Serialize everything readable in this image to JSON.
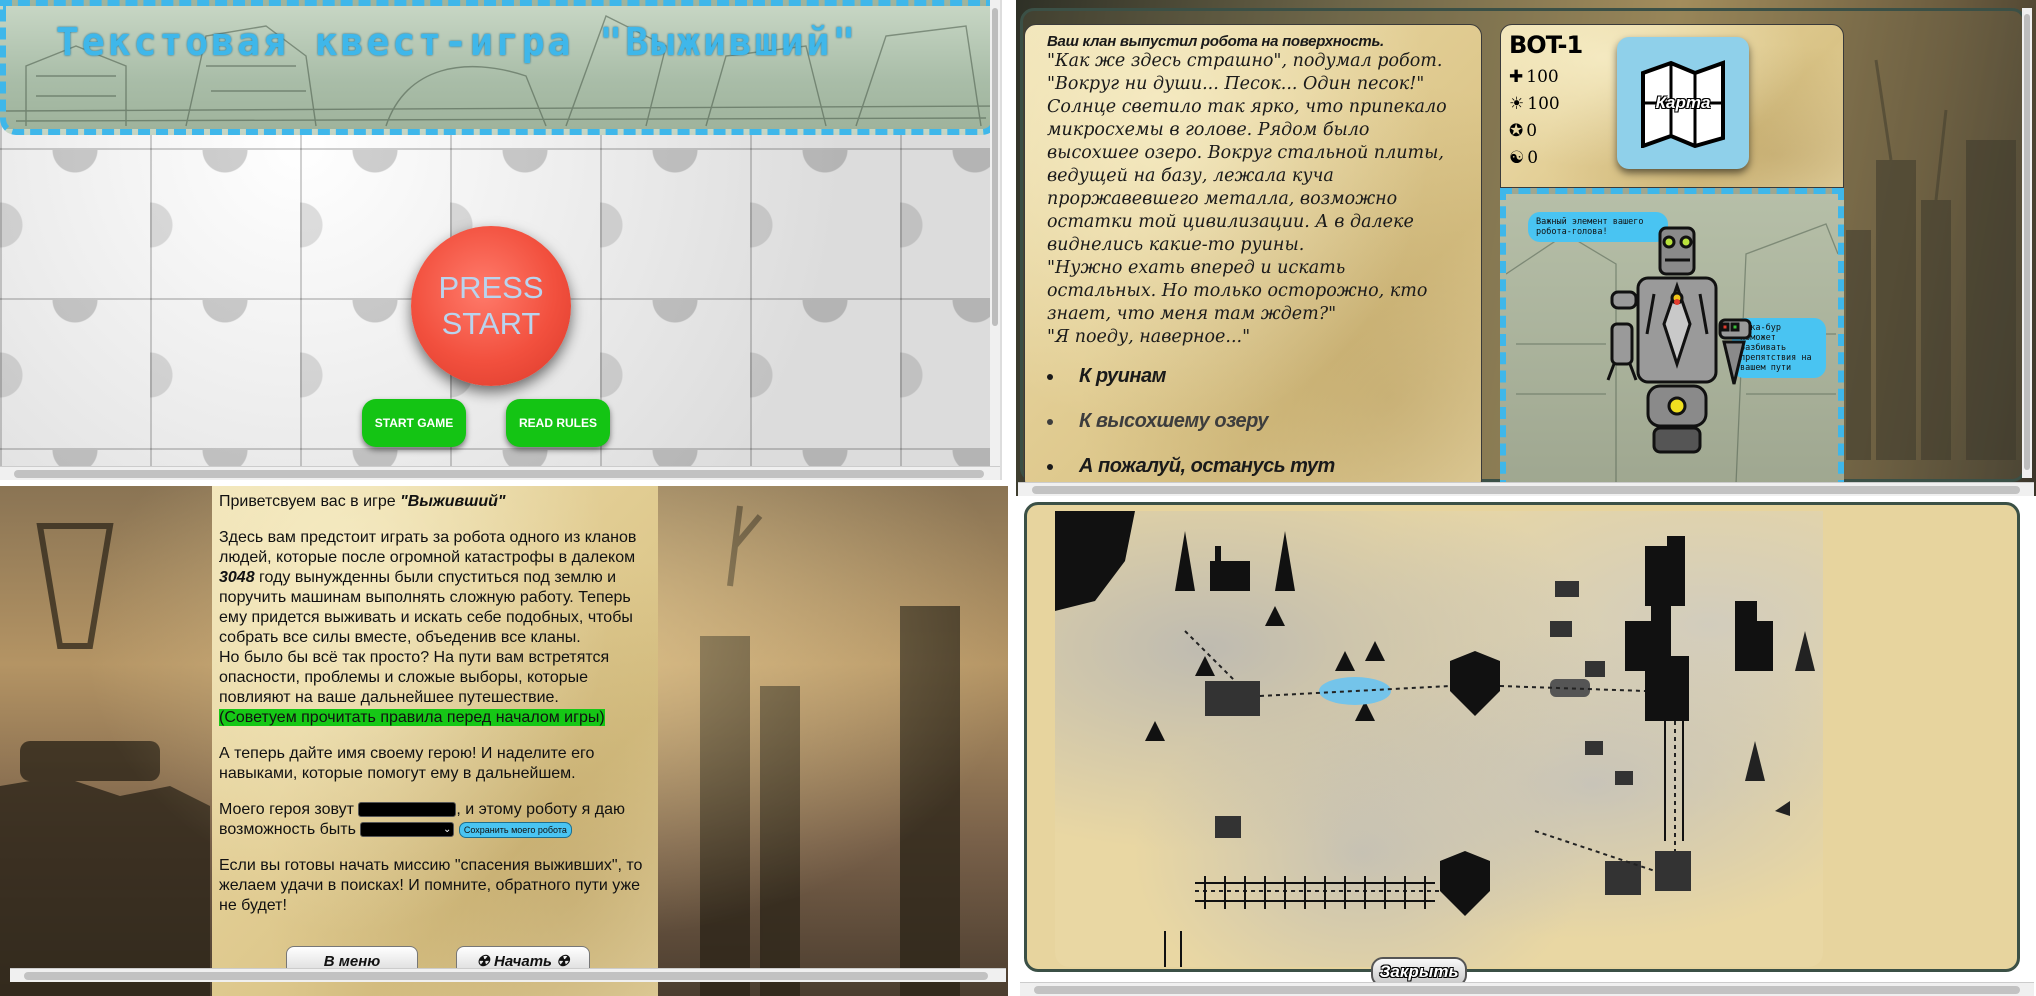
{
  "start_screen": {
    "title": "Текстовая квест-игра \"Выживший\"",
    "press_start_line1": "PRESS",
    "press_start_line2": "START",
    "start_game_label": "START GAME",
    "read_rules_label": "READ RULES"
  },
  "story_screen": {
    "lead": "Ваш клан выпустил робота на поверхность.",
    "paragraphs": [
      "\"Как же здесь страшно\", подумал робот. \"Вокруг ни души... Песок... Один песок!\"",
      "Солнце светило так ярко, что припекало микросхемы в голове. Рядом было высохшее озеро. Вокруг стальной плиты, ведущей на базу, лежала куча проржавевшего металла, возможно остатки той цивилизации. А в далеке виднелись какие-то руины.",
      "\"Нужно ехать вперед и искать остальных. Но только осторожно, кто знает, что меня там ждет?\"",
      "\"Я поеду, наверное...\""
    ],
    "choices": [
      "К руинам",
      "К высохшему озеру",
      "А пожалуй, останусь тут"
    ],
    "bot_name": "BOT-1",
    "stats": [
      {
        "icon": "health-icon",
        "glyph": "✚",
        "value": "100"
      },
      {
        "icon": "energy-icon",
        "glyph": "☀",
        "value": "100"
      },
      {
        "icon": "coin-icon",
        "glyph": "✪",
        "value": "0"
      },
      {
        "icon": "karma-icon",
        "glyph": "☯",
        "value": "0"
      }
    ],
    "map_button_label": "Карта",
    "bubble_head": "Важный элемент вашего робота-голова!",
    "bubble_arm": "Рука-бур поможет разбивать препятствия на вашем пути"
  },
  "intro_screen": {
    "greeting_prefix": "Приветсвуем вас в игре ",
    "game_name": "\"Выживший\"",
    "story_p1_a": "Здесь вам предстоит играть за робота одного из кланов людей, которые после огромной катастрофы в далеком ",
    "year": "3048",
    "story_p1_b": " году вынужденны были спуститься под землю и поручить машинам выполнять сложную работу. Теперь ему придется выживать и искать себе подобных, чтобы собрать все силы вместе, объеденив все кланы.",
    "story_p2": "Но было бы всё так просто? На пути вам встретятся опасности, проблемы и сложые выборы, которые повлияют на ваше дальнейшее путешествие.",
    "rules_hint": "(Советуем прочитать правила перед началом игры)",
    "name_prompt": "А теперь дайте имя своему герою! И наделите его навыками, которые помогут ему в дальнейшем.",
    "name_label_a": "Моего героя зовут ",
    "name_label_b": ", и этому роботу я даю возможность быть ",
    "save_button_label": "Сохранить моего робота",
    "farewell": "Если вы готовы начать миссию \"спасения выживших\", то желаем удачи в поисках! И помните, обратного пути уже не будет!",
    "menu_button_label": "В меню",
    "start_button_label": "☢ Начать ☢"
  },
  "map_screen": {
    "close_button_label": "Закрыть"
  },
  "colors": {
    "accent_blue": "#3fb7ea",
    "start_green": "#14c414",
    "press_red": "#f2503e",
    "parchment": "#e1cc92"
  }
}
